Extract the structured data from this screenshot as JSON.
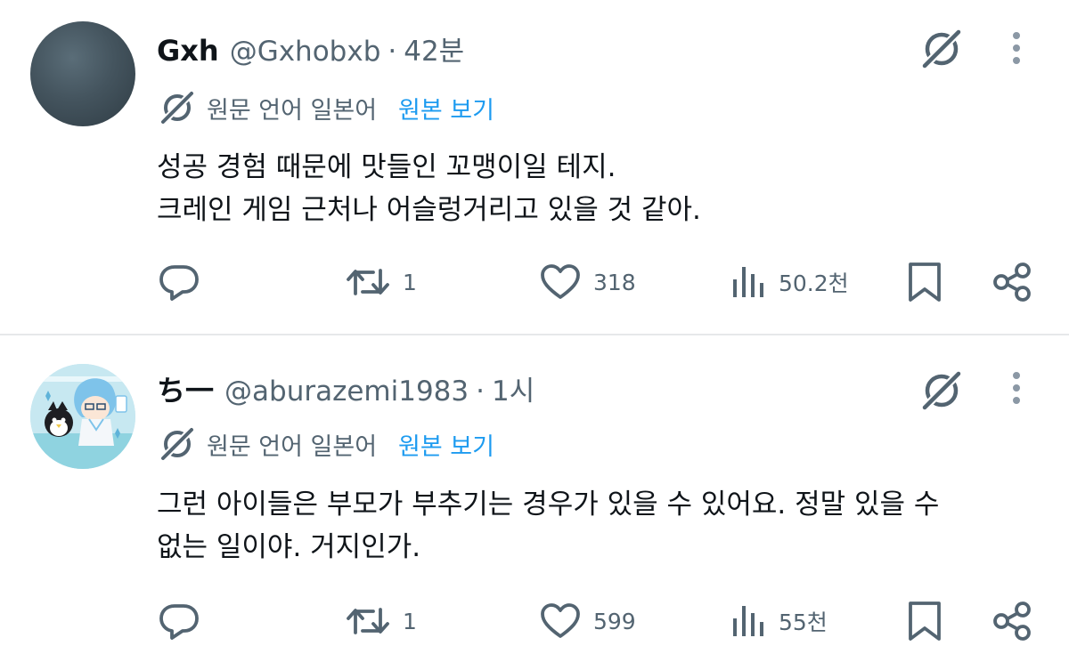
{
  "tweets": [
    {
      "display_name": "Gxh",
      "handle": "@Gxhobxb",
      "separator": "·",
      "time": "42분",
      "translation_label": "원문 언어 일본어",
      "show_original_label": "원본 보기",
      "text_lines": [
        "성공 경험 때문에 맛들인 꼬맹이일 테지.",
        "크레인 게임 근처나 어슬렁거리고 있을 것 같아."
      ],
      "retweets": "1",
      "likes": "318",
      "views": "50.2천"
    },
    {
      "display_name": "ち一",
      "handle": "@aburazemi1983",
      "separator": "·",
      "time": "1시",
      "translation_label": "원문 언어 일본어",
      "show_original_label": "원본 보기",
      "text_lines": [
        "그런 아이들은 부모가 부추기는 경우가 있을 수 있어요. 정말 있을 수",
        "없는 일이야. 거지인가."
      ],
      "retweets": "1",
      "likes": "599",
      "views": "55천"
    }
  ],
  "colors": {
    "text_primary": "#0f1419",
    "text_secondary": "#536471",
    "link_blue": "#1d9bf0",
    "divider": "#e6e8ea"
  },
  "icons": [
    "grok-icon",
    "more-vertical-icon",
    "translate-icon",
    "reply-icon",
    "retweet-icon",
    "like-icon",
    "views-icon",
    "bookmark-icon",
    "share-icon"
  ]
}
